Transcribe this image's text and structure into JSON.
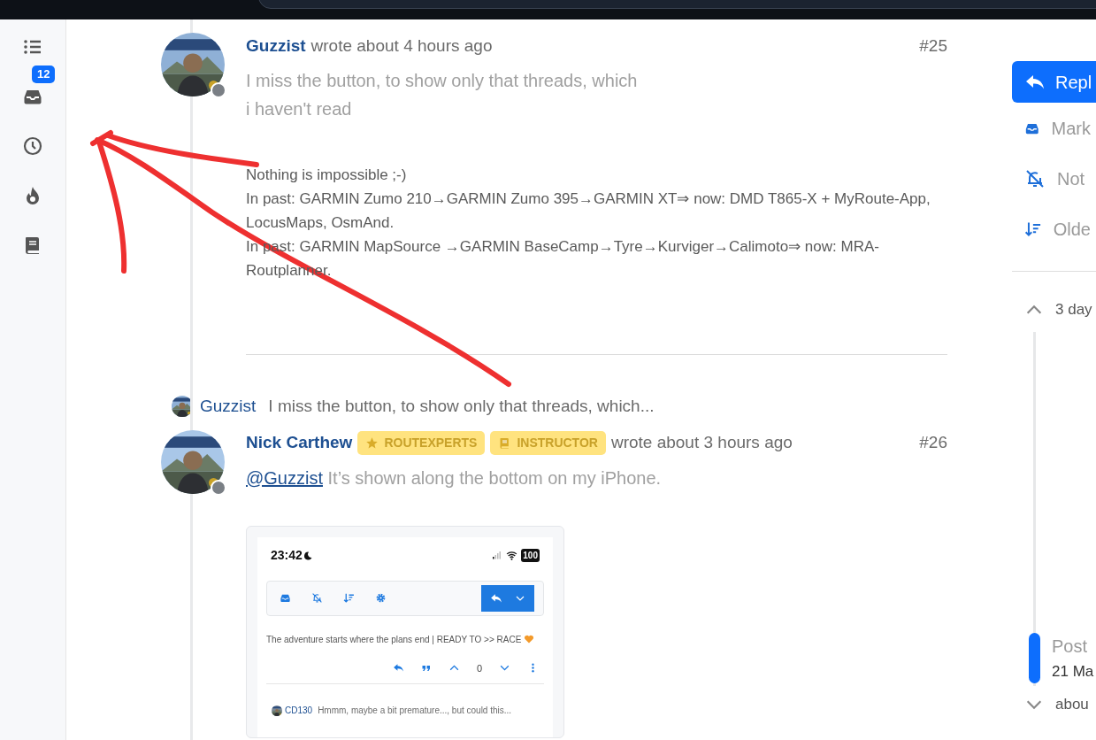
{
  "sidebar": {
    "unread_badge": "12"
  },
  "posts": [
    {
      "author": "Guzzist",
      "online": false,
      "meta": "wrote about 4 hours ago",
      "index": "#25",
      "body": "I miss the button, to show only that threads, which\ni haven't read",
      "signature": [
        "Nothing is impossible ;-)",
        "In past: GARMIN Zumo 210→GARMIN Zumo 395→GARMIN XT⇒ now: DMD T865-X + MyRoute-App, LocusMaps, OsmAnd.",
        "In past: GARMIN MapSource →GARMIN BaseCamp→Tyre→Kurviger→Calimoto⇒ now: MRA-Routplanner."
      ]
    },
    {
      "reply_to": {
        "author": "Guzzist",
        "text": "I miss the button, to show only that threads, which..."
      },
      "author": "Nick Carthew",
      "online": false,
      "badges": [
        {
          "label": "ROUTEXPERTS"
        },
        {
          "label": "INSTRUCTOR"
        }
      ],
      "meta": "wrote about 3 hours ago",
      "index": "#26",
      "mention": "@Guzzist",
      "body": "It’s shown along the bottom on my iPhone.",
      "attachment": {
        "kind": "screenshot",
        "time": "23:42",
        "battery": "100",
        "signature": "The adventure starts where the plans end | READY TO >> RACE",
        "vote_count": "0",
        "reply_preview": {
          "author": "CD130",
          "text": "Hmmm, maybe a bit premature..., but could this..."
        }
      }
    }
  ],
  "right_panel": {
    "reply_button": "Repl",
    "actions": [
      {
        "label": "Mark"
      },
      {
        "label": "Not"
      },
      {
        "label": "Olde"
      }
    ],
    "timeline": {
      "start": "3 day",
      "current_label": "Post",
      "current_date": "21 Ma",
      "end": "abou",
      "level": 0.99
    }
  },
  "annotation": {
    "kind": "freehand-arrow"
  }
}
